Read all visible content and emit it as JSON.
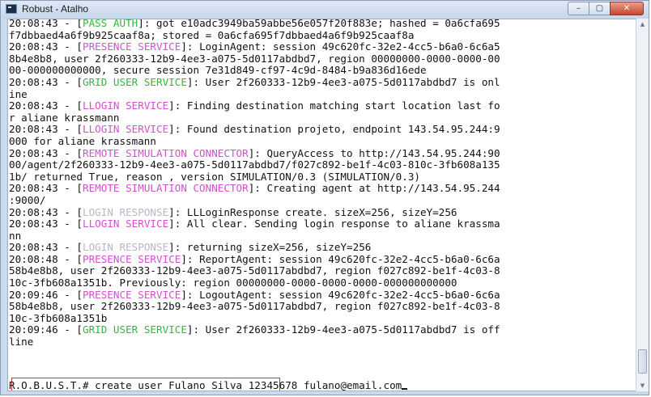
{
  "window": {
    "title": "Robust - Atalho"
  },
  "window_buttons": {
    "minimize": "–",
    "maximize": "▢",
    "close": "✕"
  },
  "scrollbar": {
    "up": "▲",
    "down": "▼",
    "position_fraction": 0.97
  },
  "colors": {
    "green": "#32b83a",
    "magenta": "#d44fcf",
    "grey": "#b7b7c7",
    "highlight_box": "#d8312c"
  },
  "console_lines": [
    [
      {
        "t": "20:08:43 - ["
      },
      {
        "t": "PASS AUTH",
        "c": "green"
      },
      {
        "t": "]: got e10adc3949ba59abbe56e057f20f883e; hashed = 0a6cfa695"
      }
    ],
    [
      {
        "t": "f7dbbaed4a6f9b925caaf8a; stored = 0a6cfa695f7dbbaed4a6f9b925caaf8a"
      }
    ],
    [
      {
        "t": "20:08:43 - ["
      },
      {
        "t": "PRESENCE SERVICE",
        "c": "magenta"
      },
      {
        "t": "]: LoginAgent: session 49c620fc-32e2-4cc5-b6a0-6c6a5"
      }
    ],
    [
      {
        "t": "8b4e8b8, user 2f260333-12b9-4ee3-a075-5d0117abdbd7, region 00000000-0000-0000-00"
      }
    ],
    [
      {
        "t": "00-000000000000, secure session 7e31d849-cf97-4c9d-8484-b9a836d16ede"
      }
    ],
    [
      {
        "t": "20:08:43 - ["
      },
      {
        "t": "GRID USER SERVICE",
        "c": "green"
      },
      {
        "t": "]: User 2f260333-12b9-4ee3-a075-5d0117abdbd7 is onl"
      }
    ],
    [
      {
        "t": "ine"
      }
    ],
    [
      {
        "t": "20:08:43 - ["
      },
      {
        "t": "LLOGIN SERVICE",
        "c": "magenta"
      },
      {
        "t": "]: Finding destination matching start location last fo"
      }
    ],
    [
      {
        "t": "r aliane krassmann"
      }
    ],
    [
      {
        "t": "20:08:43 - ["
      },
      {
        "t": "LLOGIN SERVICE",
        "c": "magenta"
      },
      {
        "t": "]: Found destination projeto, endpoint 143.54.95.244:9"
      }
    ],
    [
      {
        "t": "000 for aliane krassmann"
      }
    ],
    [
      {
        "t": "20:08:43 - ["
      },
      {
        "t": "REMOTE SIMULATION CONNECTOR",
        "c": "magenta"
      },
      {
        "t": "]: QueryAccess to http://143.54.95.244:90"
      }
    ],
    [
      {
        "t": "00/agent/2f260333-12b9-4ee3-a075-5d0117abdbd7/f027c892-be1f-4c03-810c-3fb608a135"
      }
    ],
    [
      {
        "t": "1b/ returned True, reason , version SIMULATION/0.3 (SIMULATION/0.3)"
      }
    ],
    [
      {
        "t": "20:08:43 - ["
      },
      {
        "t": "REMOTE SIMULATION CONNECTOR",
        "c": "magenta"
      },
      {
        "t": "]: Creating agent at http://143.54.95.244"
      }
    ],
    [
      {
        "t": ":9000/"
      }
    ],
    [
      {
        "t": "20:08:43 - ["
      },
      {
        "t": "LOGIN RESPONSE",
        "c": "grey"
      },
      {
        "t": "]: LLLoginResponse create. sizeX=256, sizeY=256"
      }
    ],
    [
      {
        "t": "20:08:43 - ["
      },
      {
        "t": "LLOGIN SERVICE",
        "c": "magenta"
      },
      {
        "t": "]: All clear. Sending login response to aliane krassma"
      }
    ],
    [
      {
        "t": "nn"
      }
    ],
    [
      {
        "t": "20:08:43 - ["
      },
      {
        "t": "LOGIN RESPONSE",
        "c": "grey"
      },
      {
        "t": "]: returning sizeX=256, sizeY=256"
      }
    ],
    [
      {
        "t": "20:08:48 - ["
      },
      {
        "t": "PRESENCE SERVICE",
        "c": "magenta"
      },
      {
        "t": "]: ReportAgent: session 49c620fc-32e2-4cc5-b6a0-6c6a"
      }
    ],
    [
      {
        "t": "58b4e8b8, user 2f260333-12b9-4ee3-a075-5d0117abdbd7, region f027c892-be1f-4c03-8"
      }
    ],
    [
      {
        "t": "10c-3fb608a1351b. Previously: region 00000000-0000-0000-0000-000000000000"
      }
    ],
    [
      {
        "t": "20:09:46 - ["
      },
      {
        "t": "PRESENCE SERVICE",
        "c": "magenta"
      },
      {
        "t": "]: LogoutAgent: session 49c620fc-32e2-4cc5-b6a0-6c6a"
      }
    ],
    [
      {
        "t": "58b4e8b8, user 2f260333-12b9-4ee3-a075-5d0117abdbd7, region f027c892-be1f-4c03-8"
      }
    ],
    [
      {
        "t": "10c-3fb608a1351b"
      }
    ],
    [
      {
        "t": "20:09:46 - ["
      },
      {
        "t": "GRID USER SERVICE",
        "c": "green"
      },
      {
        "t": "]: User 2f260333-12b9-4ee3-a075-5d0117abdbd7 is off"
      }
    ],
    [
      {
        "t": "line"
      }
    ]
  ],
  "command": {
    "prompt": "R.O.B.U.S.T.# ",
    "text": "create user Fulano Silva 12345678 fulano@email.com"
  }
}
